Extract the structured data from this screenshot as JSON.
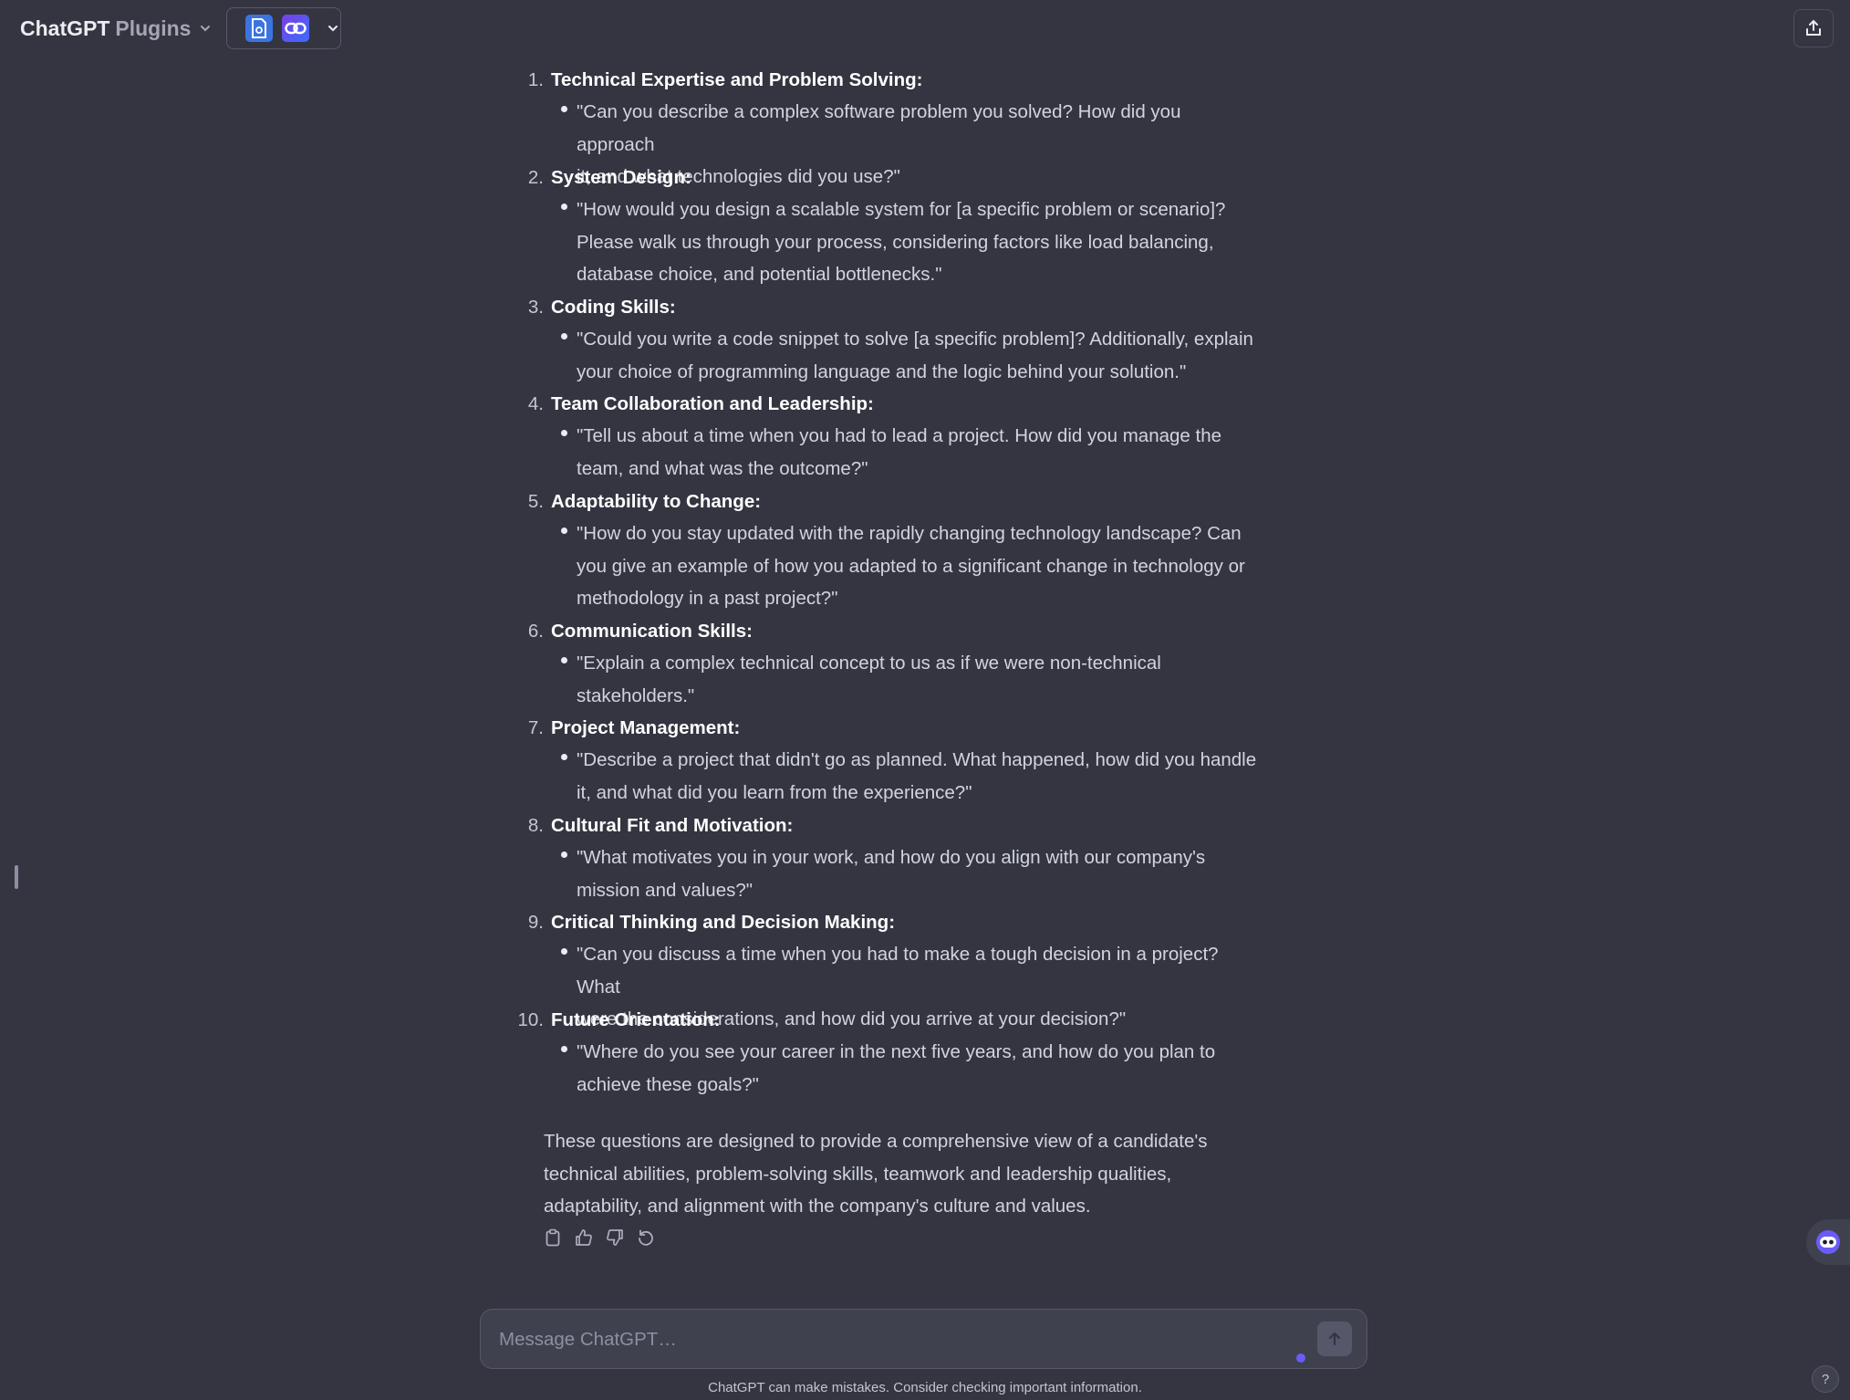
{
  "header": {
    "model_name": "ChatGPT",
    "model_variant": "Plugins",
    "model_chevron_icon": "chevron-down-icon",
    "plugins": [
      {
        "icon": "document-plugin-icon",
        "color": "#3b74e0"
      },
      {
        "icon": "link-plugin-icon",
        "color": "#6a4cf0"
      }
    ],
    "share_icon": "share-icon"
  },
  "message": {
    "questions": [
      {
        "number": "1.",
        "title": "Technical Expertise and Problem Solving:",
        "lines": [
          "\"Can you describe a complex software problem you solved? How did you approach",
          "it, and what technologies did you use?\""
        ]
      },
      {
        "number": "2.",
        "title": "System Design:",
        "lines": [
          "\"How would you design a scalable system for [a specific problem or scenario]?",
          "Please walk us through your process, considering factors like load balancing,",
          "database choice, and potential bottlenecks.\""
        ]
      },
      {
        "number": "3.",
        "title": "Coding Skills:",
        "lines": [
          "\"Could you write a code snippet to solve [a specific problem]? Additionally, explain",
          "your choice of programming language and the logic behind your solution.\""
        ]
      },
      {
        "number": "4.",
        "title": "Team Collaboration and Leadership:",
        "lines": [
          "\"Tell us about a time when you had to lead a project. How did you manage the",
          "team, and what was the outcome?\""
        ]
      },
      {
        "number": "5.",
        "title": "Adaptability to Change:",
        "lines": [
          "\"How do you stay updated with the rapidly changing technology landscape? Can",
          "you give an example of how you adapted to a significant change in technology or",
          "methodology in a past project?\""
        ]
      },
      {
        "number": "6.",
        "title": "Communication Skills:",
        "lines": [
          "\"Explain a complex technical concept to us as if we were non-technical",
          "stakeholders.\""
        ]
      },
      {
        "number": "7.",
        "title": "Project Management:",
        "lines": [
          "\"Describe a project that didn't go as planned. What happened, how did you handle",
          "it, and what did you learn from the experience?\""
        ]
      },
      {
        "number": "8.",
        "title": "Cultural Fit and Motivation:",
        "lines": [
          "\"What motivates you in your work, and how do you align with our company's",
          "mission and values?\""
        ]
      },
      {
        "number": "9.",
        "title": "Critical Thinking and Decision Making:",
        "lines": [
          "\"Can you discuss a time when you had to make a tough decision in a project? What",
          "were the considerations, and how did you arrive at your decision?\""
        ]
      },
      {
        "number": "10.",
        "title": "Future Orientation:",
        "lines": [
          "\"Where do you see your career in the next five years, and how do you plan to",
          "achieve these goals?\""
        ]
      }
    ],
    "summary": "These questions are designed to provide a comprehensive view of a candidate's technical abilities, problem-solving skills, teamwork and leadership qualities, adaptability, and alignment with the company's culture and values.",
    "actions": [
      "copy-icon",
      "thumbs-up-icon",
      "thumbs-down-icon",
      "regenerate-icon"
    ]
  },
  "composer": {
    "value": "",
    "placeholder": "Message ChatGPT…",
    "send_icon": "arrow-up-icon"
  },
  "footer": {
    "disclaimer": "ChatGPT can make mistakes. Consider checking important information.",
    "help_label": "?"
  }
}
